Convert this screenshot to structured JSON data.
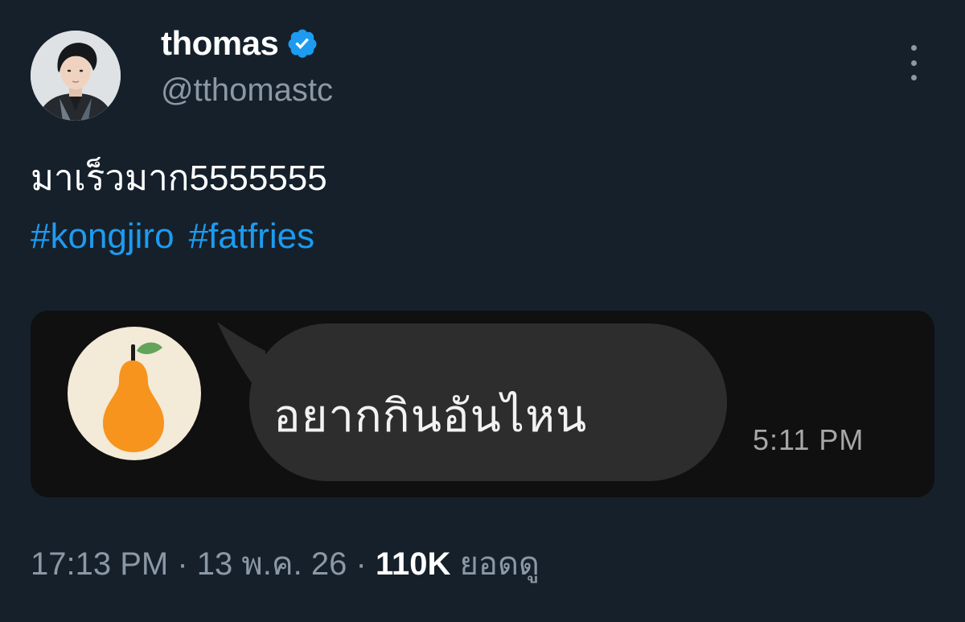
{
  "author": {
    "display_name": "thomas",
    "handle": "@tthomastc",
    "verified_icon": "verified-badge-icon"
  },
  "tweet": {
    "text": "มาเร็วมาก5555555",
    "hashtags": [
      "#kongjiro",
      "#fatfries"
    ]
  },
  "media": {
    "chat_message": "อยากกินอันไหน",
    "chat_time": "5:11 PM",
    "chat_avatar_icon": "pear-icon"
  },
  "meta": {
    "time": "17:13 PM",
    "separator": "·",
    "date": "13 พ.ค. 26",
    "views_count": "110K",
    "views_label": "ยอดดู"
  },
  "colors": {
    "background": "#15202b",
    "accent": "#1d9bf0",
    "secondary_text": "#8b98a5",
    "pear": "#f7941d",
    "leaf": "#62a45a"
  }
}
